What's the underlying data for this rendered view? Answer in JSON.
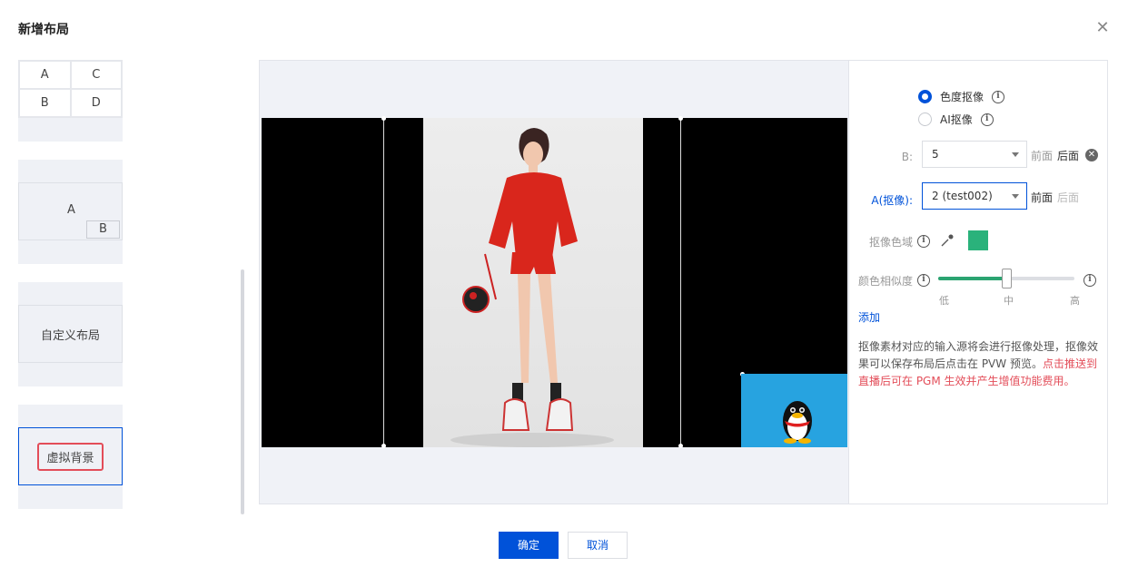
{
  "dialog": {
    "title": "新增布局",
    "close_icon": "close-icon"
  },
  "layouts": {
    "quad": [
      "A",
      "C",
      "B",
      "D"
    ],
    "pip": {
      "a": "A",
      "b": "B"
    },
    "custom": "自定义布局",
    "virtual_bg": "虚拟背景"
  },
  "settings": {
    "mode_chroma": "色度抠像",
    "mode_ai": "AI抠像",
    "b_label": "B:",
    "b_value": "5",
    "front": "前面",
    "back": "后面",
    "a_label": "A(抠像):",
    "a_value": "2 (test002)",
    "key_color_label": "抠像色域",
    "key_color": "#2ab27b",
    "similarity_label": "颜色相似度",
    "similarity_level": 0.5,
    "tick_low": "低",
    "tick_mid": "中",
    "tick_high": "高",
    "add_link": "添加",
    "desc_normal": "抠像素材对应的输入源将会进行抠像处理，抠像效果可以保存布局后点击在 PVW 预览。",
    "desc_red": "点击推送到直播后可在 PGM 生效并产生增值功能费用。"
  },
  "footer": {
    "ok": "确定",
    "cancel": "取消"
  },
  "colors": {
    "primary": "#0052d9",
    "danger": "#e34d59",
    "pip_bg": "#27a3e0"
  }
}
